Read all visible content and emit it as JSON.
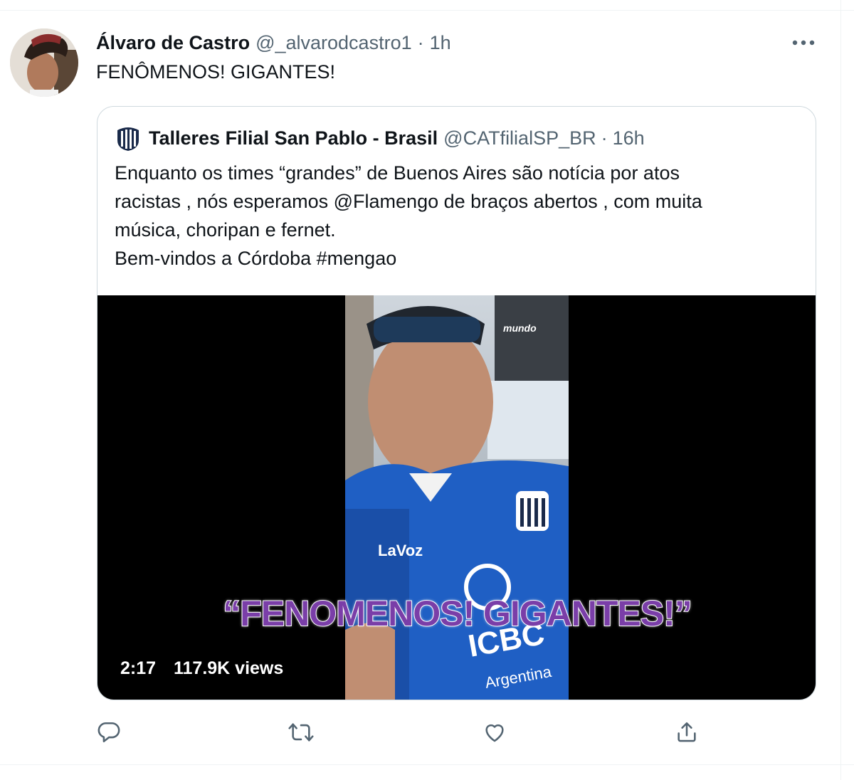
{
  "tweet": {
    "display_name": "Álvaro de Castro",
    "handle": "@_alvarodcastro1",
    "separator": "·",
    "time": "1h",
    "text": "FENÔMENOS! GIGANTES!"
  },
  "quoted_tweet": {
    "display_name": "Talleres Filial San Pablo - Brasil",
    "handle": "@CATfilialSP_BR",
    "separator": "·",
    "time": "16h",
    "text_lines": [
      "Enquanto os times “grandes” de Buenos Aires são notícia por atos",
      "racistas , nós esperamos @Flamengo de braços abertos , com muita",
      "música, choripan e fernet.",
      "Bem-vindos a Córdoba #mengao"
    ],
    "video": {
      "caption": "“FENOMENOS! GIGANTES!”",
      "duration": "2:17",
      "views": "117.9K views",
      "watermark": "mundo",
      "shirt_text": "LaVoz",
      "shirt_sponsor": "ICBC",
      "shirt_sponsor_sub": "Argentina"
    }
  },
  "actions": {
    "icons": [
      "reply-icon",
      "retweet-icon",
      "like-icon",
      "share-icon"
    ]
  },
  "colors": {
    "text_primary": "#0f1419",
    "text_secondary": "#536471",
    "border": "#cfd9de",
    "caption": "#7a3ea8",
    "jersey_blue": "#1f5fc4"
  }
}
